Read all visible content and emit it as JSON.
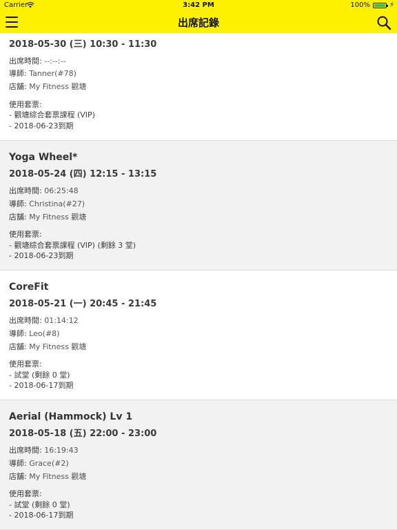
{
  "status_bar": {
    "carrier": "Carrier",
    "time": "3:42 PM",
    "battery": "100%"
  },
  "nav": {
    "title": "出席記錄"
  },
  "labels": {
    "attend_time": "出席時間:",
    "instructor": "導師:",
    "store": "店舖:",
    "ticket": "使用套票:"
  },
  "records": [
    {
      "class_name": "",
      "datetime": "2018-05-30 (三) 10:30 - 11:30",
      "attend_time": "--:--:--",
      "instructor": "Tanner(#78)",
      "store": "My Fitness 觀塘",
      "ticket_name": "- 觀塘綜合套票課程 (VIP)",
      "ticket_expiry": "- 2018-06-23到期"
    },
    {
      "class_name": "Yoga Wheel*",
      "datetime": "2018-05-24 (四) 12:15 - 13:15",
      "attend_time": "06:25:48",
      "instructor": "Christina(#27)",
      "store": "My Fitness 觀塘",
      "ticket_name": "- 觀塘綜合套票課程 (VIP) (剩餘 3 堂)",
      "ticket_expiry": "- 2018-06-23到期"
    },
    {
      "class_name": "CoreFit",
      "datetime": "2018-05-21 (一) 20:45 - 21:45",
      "attend_time": "01:14:12",
      "instructor": "Leo(#8)",
      "store": "My Fitness 觀塘",
      "ticket_name": "- 試堂 (剩餘 0 堂)",
      "ticket_expiry": "- 2018-06-17到期"
    },
    {
      "class_name": "Aerial (Hammock) Lv 1",
      "datetime": "2018-05-18 (五) 22:00 - 23:00",
      "attend_time": "16:19:43",
      "instructor": "Grace(#2)",
      "store": "My Fitness 觀塘",
      "ticket_name": "- 試堂 (剩餘 0 堂)",
      "ticket_expiry": "- 2018-06-17到期"
    }
  ],
  "colors": {
    "nav_bar": "#fff200",
    "alt_row": "#f2f2f2",
    "battery": "#38c23a"
  },
  "icons": {
    "menu": "hamburger-icon",
    "search": "search-icon",
    "wifi": "wifi-icon",
    "battery": "battery-icon",
    "charging": "bolt-icon"
  }
}
